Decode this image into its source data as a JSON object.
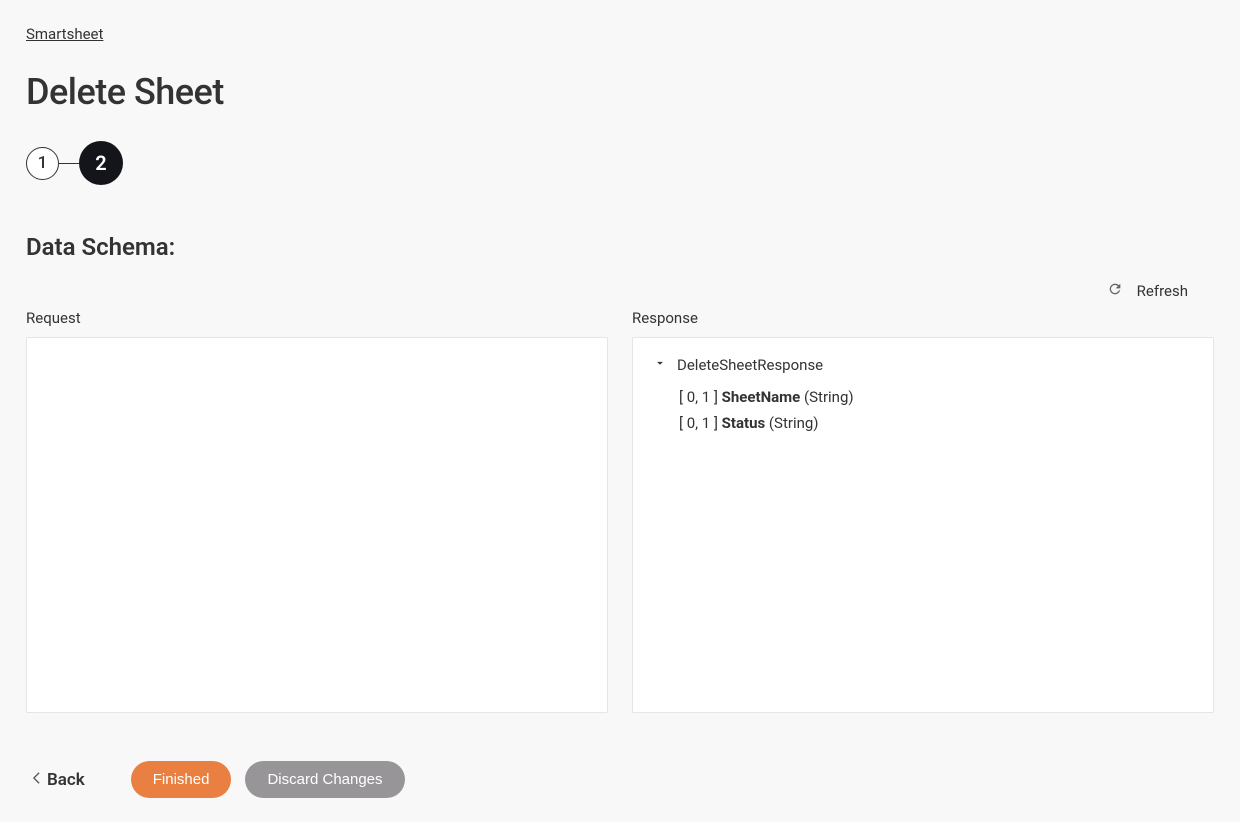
{
  "breadcrumb": {
    "link_text": "Smartsheet"
  },
  "page": {
    "title": "Delete Sheet"
  },
  "stepper": {
    "step1": "1",
    "step2": "2"
  },
  "section": {
    "heading": "Data Schema:"
  },
  "refresh": {
    "label": "Refresh"
  },
  "panels": {
    "request": {
      "label": "Request"
    },
    "response": {
      "label": "Response",
      "root_name": "DeleteSheetResponse",
      "fields": [
        {
          "cardinality": "[ 0, 1 ] ",
          "name": "SheetName",
          "type": " (String)"
        },
        {
          "cardinality": "[ 0, 1 ] ",
          "name": "Status",
          "type": " (String)"
        }
      ]
    }
  },
  "footer": {
    "back_label": "Back",
    "finished_label": "Finished",
    "discard_label": "Discard Changes"
  }
}
